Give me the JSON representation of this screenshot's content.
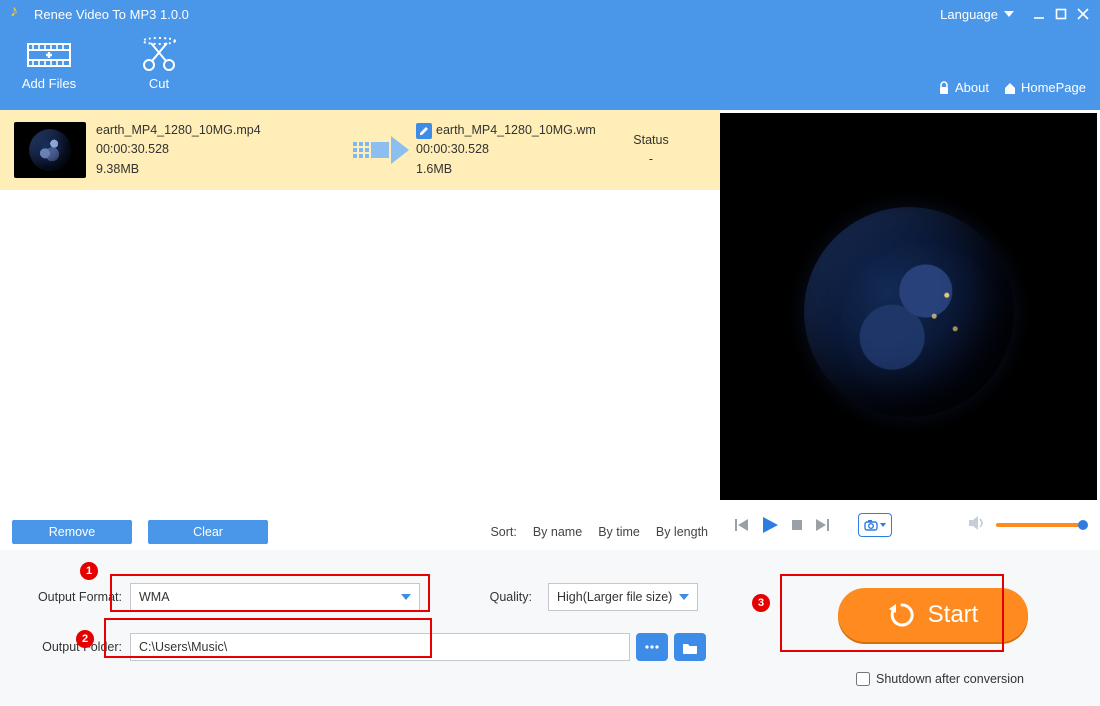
{
  "app": {
    "title": "Renee Video To MP3 1.0.0",
    "language_label": "Language"
  },
  "toolbar": {
    "add_files": "Add Files",
    "cut": "Cut",
    "about": "About",
    "homepage": "HomePage"
  },
  "file_row": {
    "src_name": "earth_MP4_1280_10MG.mp4",
    "src_duration": "00:00:30.528",
    "src_size": "9.38MB",
    "dst_name": "earth_MP4_1280_10MG.wm",
    "dst_duration": "00:00:30.528",
    "dst_size": "1.6MB",
    "status_label": "Status",
    "status_value": "-"
  },
  "list_actions": {
    "remove": "Remove",
    "clear": "Clear",
    "sort_label": "Sort:",
    "by_name": "By name",
    "by_time": "By time",
    "by_length": "By length"
  },
  "settings": {
    "output_format_label": "Output Format:",
    "output_format_value": "WMA",
    "quality_label": "Quality:",
    "quality_value": "High(Larger file size)",
    "output_folder_label": "Output Folder:",
    "output_folder_value": "C:\\Users\\Music\\",
    "start_label": "Start",
    "shutdown_label": "Shutdown after conversion"
  },
  "annotations": {
    "b1": "1",
    "b2": "2",
    "b3": "3"
  }
}
